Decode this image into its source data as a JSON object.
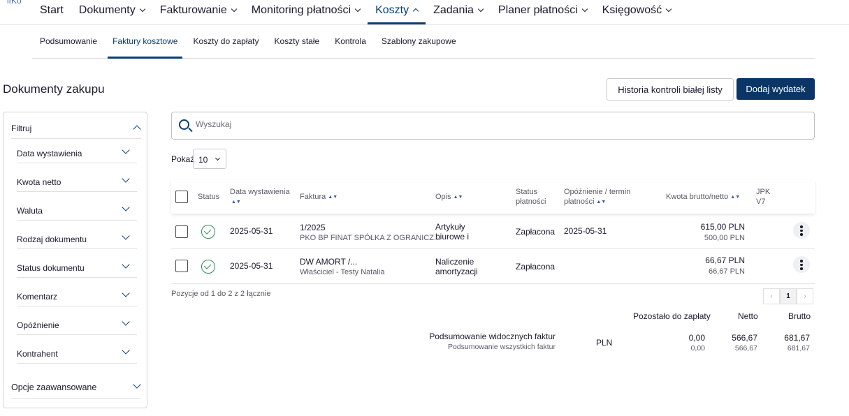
{
  "app": {
    "logo": "ifKo"
  },
  "top_nav": [
    {
      "label": "Start",
      "chevron": false
    },
    {
      "label": "Dokumenty",
      "chevron": true
    },
    {
      "label": "Fakturowanie",
      "chevron": true
    },
    {
      "label": "Monitoring płatności",
      "chevron": true
    },
    {
      "label": "Koszty",
      "chevron": true,
      "active": true
    },
    {
      "label": "Zadania",
      "chevron": true
    },
    {
      "label": "Planer płatności",
      "chevron": true
    },
    {
      "label": "Księgowość",
      "chevron": true
    }
  ],
  "sub_nav": [
    {
      "label": "Podsumowanie"
    },
    {
      "label": "Faktury kosztowe",
      "active": true
    },
    {
      "label": "Koszty do zapłaty"
    },
    {
      "label": "Koszty stałe"
    },
    {
      "label": "Kontrola"
    },
    {
      "label": "Szablony zakupowe"
    }
  ],
  "page": {
    "title": "Dokumenty zakupu",
    "history_button": "Historia kontroli białej listy",
    "add_button": "Dodaj wydatek"
  },
  "filters": {
    "header": "Filtruj",
    "items": [
      "Data wystawienia",
      "Kwota netto",
      "Waluta",
      "Rodzaj dokumentu",
      "Status dokumentu",
      "Komentarz",
      "Opóźnienie",
      "Kontrahent"
    ],
    "advanced": "Opcje zaawansowane"
  },
  "search": {
    "placeholder": "Wyszukaj"
  },
  "page_size": {
    "label": "Pokaż",
    "value": "10"
  },
  "table": {
    "columns": {
      "status": "Status",
      "date": "Data wystawienia",
      "invoice": "Faktura",
      "description": "Opis",
      "payment_status_1": "Status",
      "payment_status_2": "płatności",
      "delay_1": "Opóźnienie / termin",
      "delay_2": "płatności",
      "amount": "Kwota brutto/netto",
      "jpk_1": "JPK",
      "jpk_2": "V7"
    },
    "rows": [
      {
        "date": "2025-05-31",
        "invoice": "1/2025",
        "party": "PKO BP FINAT SPÓŁKA Z OGRANICZ...",
        "desc_1": "Artykuły",
        "desc_2": "biurowe i",
        "payment_status": "Zapłacona",
        "due": "2025-05-31",
        "gross": "615,00 PLN",
        "net": "500,00 PLN"
      },
      {
        "date": "2025-05-31",
        "invoice": "DW AMORT /...",
        "party": "Właściciel - Testy Natalia",
        "desc_1": "Naliczenie",
        "desc_2": "amortyzacji",
        "payment_status": "Zapłacona",
        "due": "",
        "gross": "66,67 PLN",
        "net": "66,67 PLN"
      }
    ]
  },
  "pagination": {
    "summary": "Pozycje od 1 do 2 z 2 łącznie",
    "prev": "‹",
    "current": "1",
    "next": "›"
  },
  "summary": {
    "col_remaining": "Pozostało do zapłaty",
    "col_net": "Netto",
    "col_gross": "Brutto",
    "visible_label": "Podsumowanie widocznych faktur",
    "all_label": "Podsumowanie wszystkich faktur",
    "currency": "PLN",
    "visible": {
      "remaining": "0,00",
      "net": "566,67",
      "gross": "681,67"
    },
    "all": {
      "remaining": "0,00",
      "net": "566,67",
      "gross": "681,67"
    }
  },
  "colors": {
    "primary": "#0a3566",
    "accent": "#0a3d73",
    "ok": "#2e8b57"
  }
}
